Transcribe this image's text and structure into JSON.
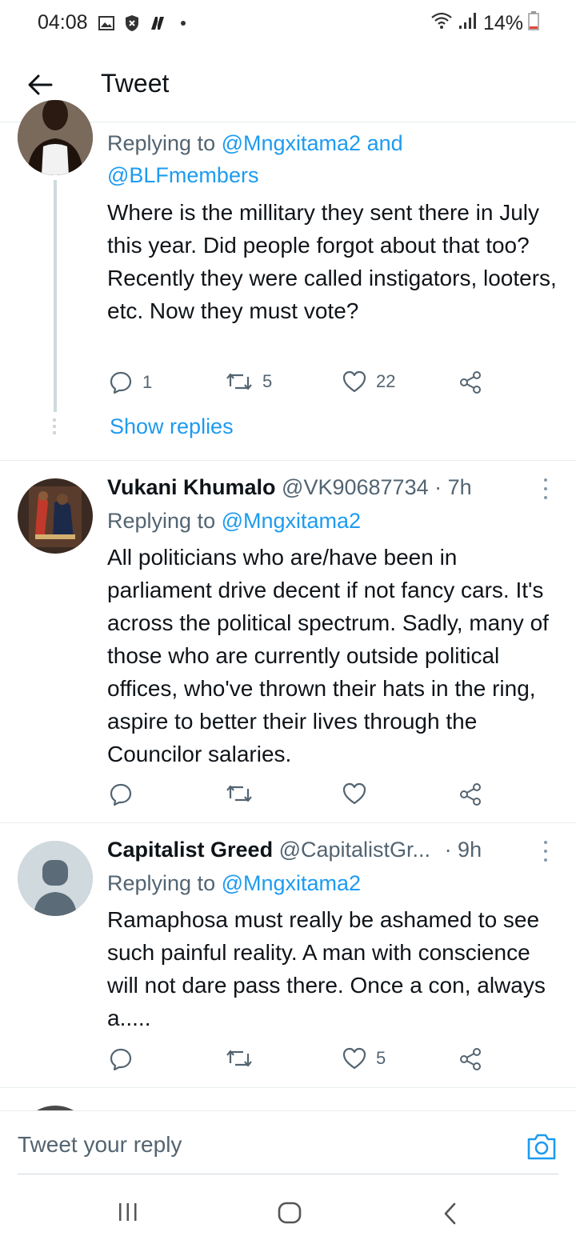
{
  "status_bar": {
    "time": "04:08",
    "battery": "14%"
  },
  "header": {
    "title": "Tweet"
  },
  "tweets": [
    {
      "replying_prefix": "Replying to ",
      "replying_to_1": "@Mngxitama2",
      "replying_and": " and",
      "replying_to_2": "@BLFmembers",
      "text": "Where is the millitary they sent there in July this year. Did people forgot about that too? Recently they were called instigators, looters, etc. Now they must vote?",
      "reply_count": "1",
      "retweet_count": "5",
      "like_count": "22",
      "show_replies": "Show replies"
    },
    {
      "name": "Vukani Khumalo",
      "handle": "@VK90687734",
      "time": "· 7h",
      "replying_prefix": "Replying to ",
      "replying_to": "@Mngxitama2",
      "text": "All politicians who are/have been in parliament drive decent if not fancy cars. It's across the political spectrum. Sadly, many of those who are currently outside political offices, who've thrown their hats in the ring, aspire to better their lives through the Councilor salaries.",
      "reply_count": "",
      "retweet_count": "",
      "like_count": ""
    },
    {
      "name": "Capitalist Greed",
      "handle": "@CapitalistGr...",
      "time": "· 9h",
      "replying_prefix": "Replying to ",
      "replying_to": "@Mngxitama2",
      "text": "Ramaphosa must really be ashamed to see such painful reality. A man with conscience will not dare pass there. Once a con, always a.....",
      "reply_count": "",
      "retweet_count": "",
      "like_count": "5"
    }
  ],
  "reply_bar": {
    "placeholder": "Tweet your reply"
  },
  "icons": {
    "back": "arrow-left-icon",
    "reply": "reply-bubble-icon",
    "retweet": "retweet-icon",
    "like": "heart-icon",
    "share": "share-icon",
    "camera": "camera-icon",
    "more": "more-vertical-icon"
  },
  "colors": {
    "accent": "#1d9bf0",
    "secondary_text": "#536471",
    "divider": "#e6ecf0"
  }
}
